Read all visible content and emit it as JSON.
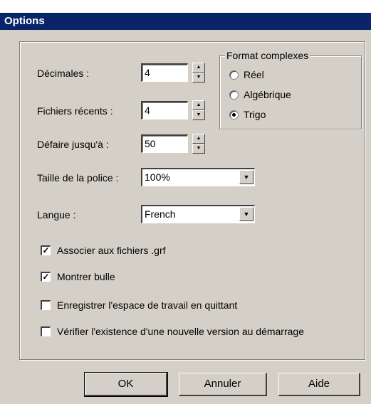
{
  "window": {
    "title": "Options"
  },
  "decimales": {
    "label": "Décimales :",
    "value": "4"
  },
  "fichiers": {
    "label": "Fichiers récents :",
    "value": "4"
  },
  "defaire": {
    "label": "Défaire jusqu'à :",
    "value": "50"
  },
  "taille": {
    "label": "Taille de la police :",
    "value": "100%"
  },
  "langue": {
    "label": "Langue :",
    "value": "French"
  },
  "format": {
    "title": "Format complexes",
    "options": [
      {
        "label": "Réel",
        "selected": false
      },
      {
        "label": "Algébrique",
        "selected": false
      },
      {
        "label": "Trigo",
        "selected": true
      }
    ]
  },
  "checkboxes": [
    {
      "label": "Associer aux fichiers .grf",
      "checked": true
    },
    {
      "label": "Montrer bulle",
      "checked": true
    },
    {
      "label": "Enregistrer l'espace de travail en quittant",
      "checked": false
    },
    {
      "label": "Vérifier l'existence d'une nouvelle version au démarrage",
      "checked": false
    }
  ],
  "buttons": {
    "ok": "OK",
    "cancel": "Annuler",
    "help": "Aide"
  }
}
